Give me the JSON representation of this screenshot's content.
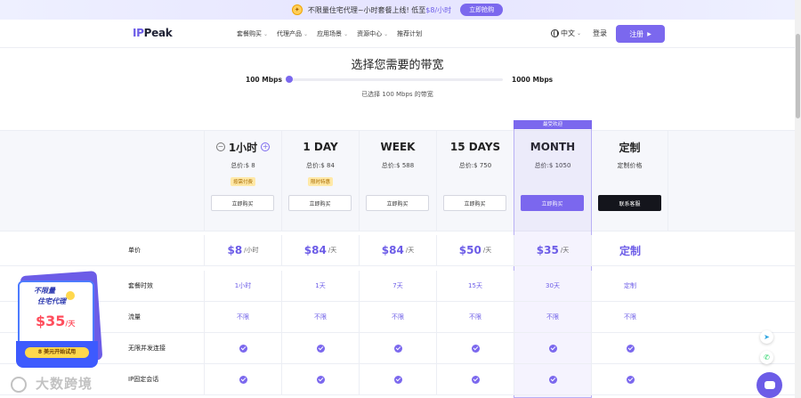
{
  "promo_bar": {
    "text_prefix": "不限量住宅代理~小时套餐上线! 低至",
    "price": "$8",
    "text_suffix": "/小时",
    "button": "立即抢购"
  },
  "nav": {
    "logo_ip": "IP",
    "logo_rest": "Peak",
    "menu": [
      "套餐购买",
      "代理产品",
      "应用场景",
      "资源中心",
      "推荐计划"
    ],
    "language": "中文",
    "login": "登录",
    "register": "注册"
  },
  "bandwidth": {
    "title": "选择您需要的带宽",
    "min": "100 Mbps",
    "max": "1000 Mbps",
    "selected_text": "已选择 100 Mbps 的带宽",
    "slider_fraction": 0.0
  },
  "plans": [
    {
      "name": "1小时",
      "total": "总价:$ 8",
      "tag": "按需付费",
      "button": "立即购买",
      "style": "default"
    },
    {
      "name": "1 DAY",
      "total": "总价:$ 84",
      "tag": "限时特惠",
      "button": "立即购买",
      "style": "default"
    },
    {
      "name": "WEEK",
      "total": "总价:$ 588",
      "tag": "",
      "button": "立即购买",
      "style": "default"
    },
    {
      "name": "15 DAYS",
      "total": "总价:$ 750",
      "tag": "",
      "button": "立即购买",
      "style": "default"
    },
    {
      "name": "MONTH",
      "total": "总价:$ 1050",
      "tag": "",
      "button": "立即购买",
      "style": "primary"
    },
    {
      "name": "定制",
      "total": "定制价格",
      "tag": "",
      "button": "联系客服",
      "style": "dark"
    }
  ],
  "recommended_badge": "最受欢迎",
  "features": {
    "unit_price": {
      "label": "单价",
      "values": [
        {
          "v": "$8",
          "u": "/小时"
        },
        {
          "v": "$84",
          "u": "/天"
        },
        {
          "v": "$84",
          "u": "/天"
        },
        {
          "v": "$50",
          "u": "/天"
        },
        {
          "v": "$35",
          "u": "/天"
        },
        {
          "v": "定制",
          "u": ""
        }
      ]
    },
    "duration": {
      "label": "套餐时效",
      "values": [
        "1小时",
        "1天",
        "7天",
        "15天",
        "30天",
        "定制"
      ]
    },
    "traffic": {
      "label": "流量",
      "values": [
        "不限",
        "不限",
        "不限",
        "不限",
        "不限",
        "不限"
      ]
    },
    "concurrency": {
      "label": "无限并发连接"
    },
    "ip_session": {
      "label": "IP固定会话"
    }
  },
  "promo_card": {
    "line1": "不限量",
    "line2": "住宅代理",
    "price": "$35",
    "unit": "/天",
    "button": "8 美元开始试用"
  },
  "watermark": "大数跨境",
  "colors": {
    "accent": "#7b68ee",
    "price_red": "#ff4d5c",
    "dark_button": "#14151c"
  }
}
